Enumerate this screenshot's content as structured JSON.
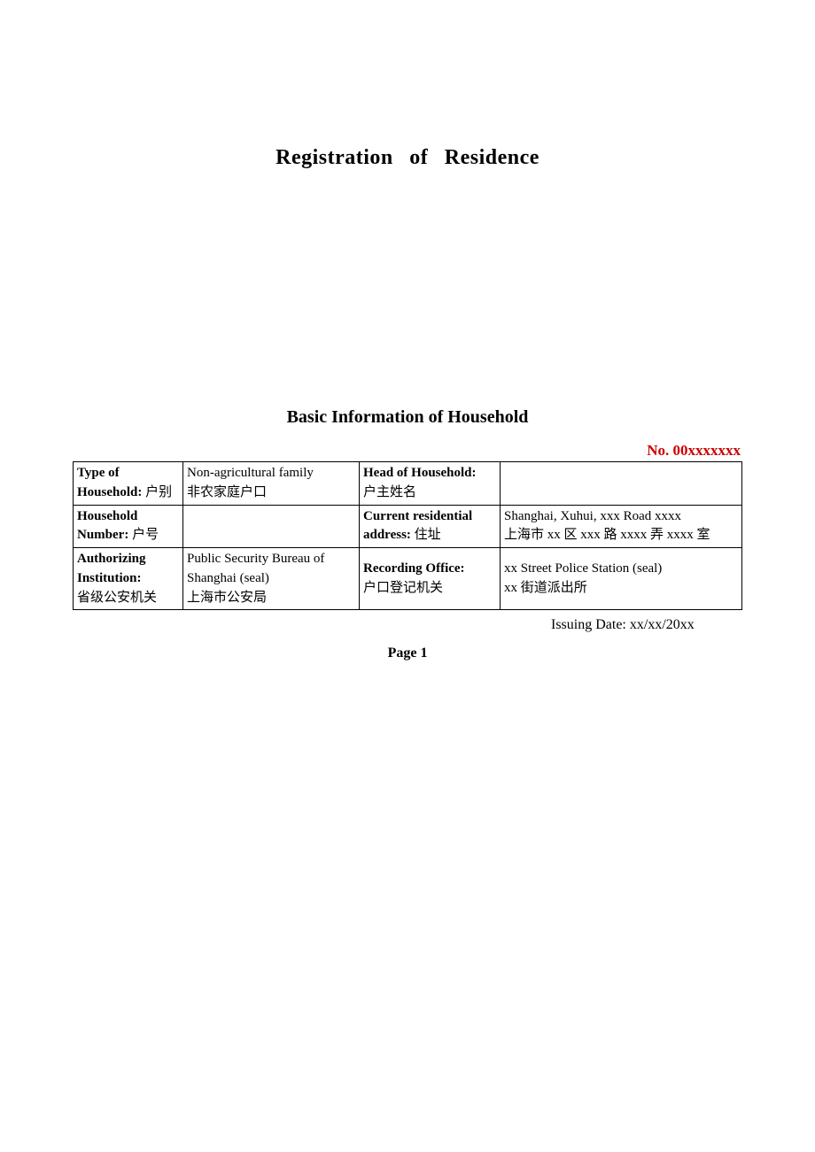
{
  "title": "Registration   of   Residence",
  "subtitle": "Basic Information of Household",
  "doc_number_label": "No.",
  "doc_number_value": "00xxxxxxx",
  "rows": {
    "type_label_en": "Type of Household:",
    "type_label_cn": "户别",
    "type_value_en": "Non-agricultural family",
    "type_value_cn": "非农家庭户口",
    "head_label_en": "Head of Household:",
    "head_label_cn": "户主姓名",
    "head_value": "",
    "household_no_label_en": "Household Number:",
    "household_no_label_cn": "户号",
    "household_no_value": "",
    "address_label_en": "Current residential address:",
    "address_label_cn": "住址",
    "address_value_en": "Shanghai, Xuhui, xxx Road xxxx",
    "address_value_cn": "上海市 xx 区 xxx 路 xxxx 弄 xxxx 室",
    "auth_label_en": "Authorizing Institution:",
    "auth_label_cn": "省级公安机关",
    "auth_value_en": "Public Security Bureau of Shanghai (seal)",
    "auth_value_cn": "上海市公安局",
    "recording_label_en": "Recording Office:",
    "recording_label_cn": "户口登记机关",
    "recording_value_en": "xx Street Police Station (seal)",
    "recording_value_cn": "xx 街道派出所"
  },
  "issuing_date_label": "Issuing Date:",
  "issuing_date_value": "xx/xx/20xx",
  "page_label": "Page 1"
}
